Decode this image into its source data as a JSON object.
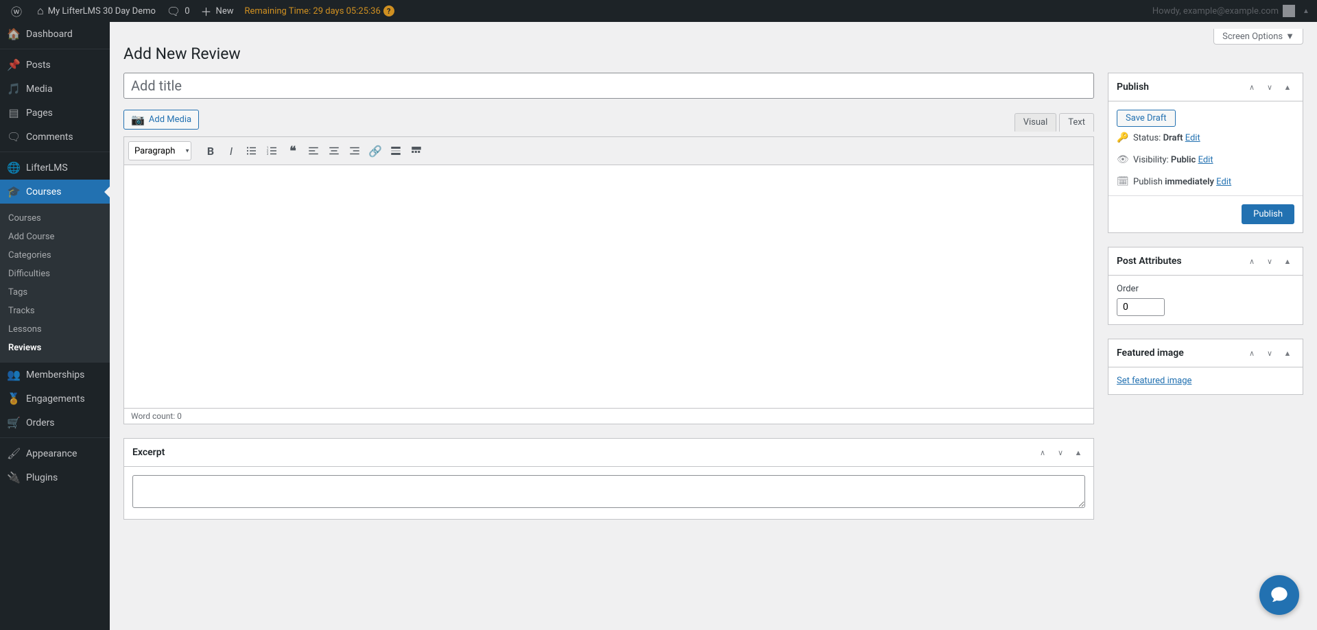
{
  "adminbar": {
    "site_name": "My LifterLMS 30 Day Demo",
    "comments_count": "0",
    "new_label": "New",
    "remaining_label": "Remaining Time: 29 days 05:25:36",
    "user_greeting": "Howdy, example@example.com"
  },
  "sidebar": {
    "items": [
      {
        "label": "Dashboard",
        "icon": "dashboard-icon"
      },
      {
        "label": "Posts",
        "icon": "pin-icon"
      },
      {
        "label": "Media",
        "icon": "media-icon"
      },
      {
        "label": "Pages",
        "icon": "page-icon"
      },
      {
        "label": "Comments",
        "icon": "comment-icon"
      },
      {
        "label": "LifterLMS",
        "icon": "globe-icon"
      },
      {
        "label": "Courses",
        "icon": "cap-icon"
      },
      {
        "label": "Memberships",
        "icon": "group-icon"
      },
      {
        "label": "Engagements",
        "icon": "badge-icon"
      },
      {
        "label": "Orders",
        "icon": "cart-icon"
      },
      {
        "label": "Appearance",
        "icon": "brush-icon"
      },
      {
        "label": "Plugins",
        "icon": "plug-icon"
      }
    ],
    "submenu": [
      "Courses",
      "Add Course",
      "Categories",
      "Difficulties",
      "Tags",
      "Tracks",
      "Lessons",
      "Reviews"
    ]
  },
  "screen_options_label": "Screen Options",
  "page_title": "Add New Review",
  "title_placeholder": "Add title",
  "add_media_label": "Add Media",
  "editor_tabs": {
    "visual": "Visual",
    "text": "Text"
  },
  "format_select": "Paragraph",
  "word_count": "Word count: 0",
  "excerpt_title": "Excerpt",
  "publish": {
    "title": "Publish",
    "save_draft": "Save Draft",
    "status_label": "Status:",
    "status_value": "Draft",
    "visibility_label": "Visibility:",
    "visibility_value": "Public",
    "publish_label": "Publish",
    "publish_value": "immediately",
    "edit": "Edit",
    "publish_btn": "Publish"
  },
  "post_attributes": {
    "title": "Post Attributes",
    "order_label": "Order",
    "order_value": "0"
  },
  "featured_image": {
    "title": "Featured image",
    "set_link": "Set featured image"
  }
}
